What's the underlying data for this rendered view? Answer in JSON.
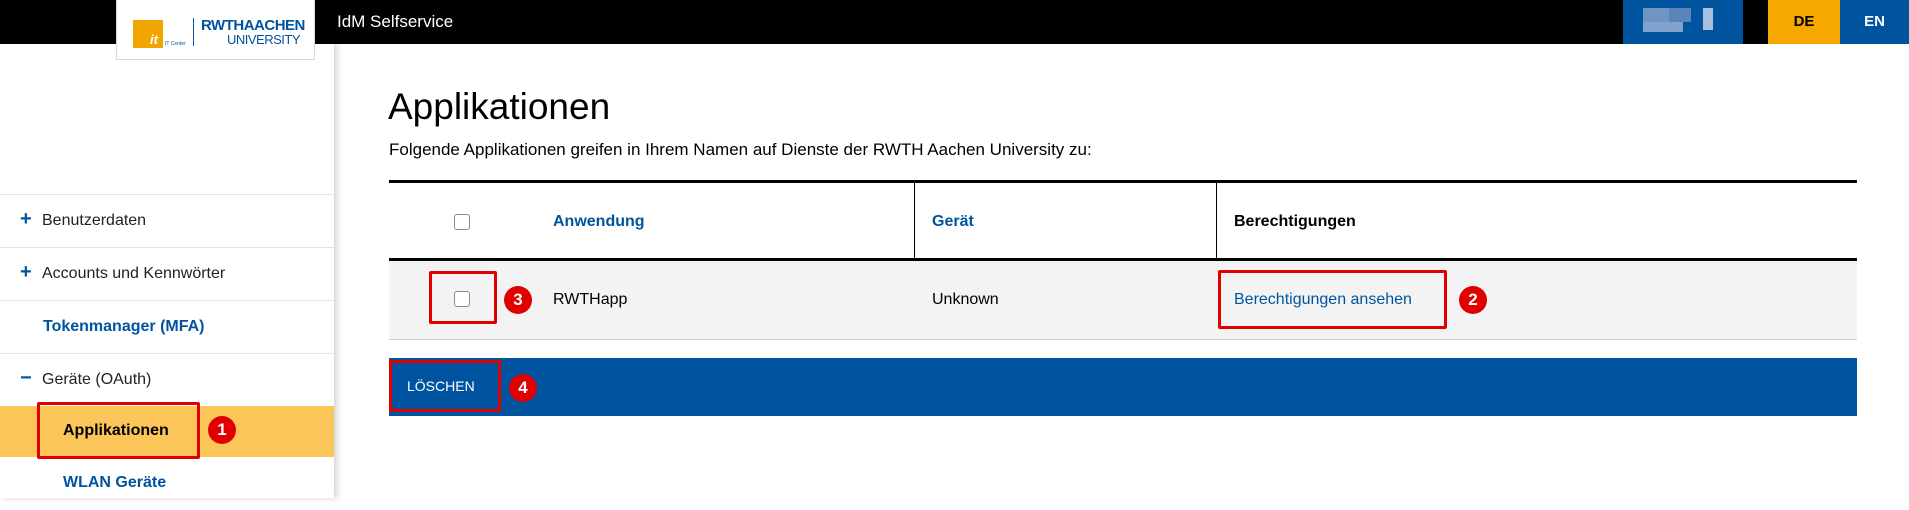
{
  "header": {
    "app_title": "IdM Selfservice",
    "logo": {
      "it_text": "it",
      "it_subtext": "IT Center",
      "rwth_text": "RWTHAACHEN",
      "university_text": "UNIVERSITY"
    },
    "lang_de": "DE",
    "lang_en": "EN",
    "colors": {
      "bar": "#000000",
      "de_bg": "#f6a800",
      "en_bg": "#00549f"
    }
  },
  "sidebar": {
    "items": [
      {
        "prefix": "+",
        "label": "Benutzerdaten"
      },
      {
        "prefix": "+",
        "label": "Accounts und Kennwörter"
      },
      {
        "prefix": "",
        "label": "Tokenmanager (MFA)"
      },
      {
        "prefix": "−",
        "label": "Geräte (OAuth)"
      },
      {
        "prefix": "",
        "label": "Applikationen",
        "active": true
      },
      {
        "prefix": "",
        "label": "WLAN Geräte"
      }
    ],
    "active_color": "#fbc55a"
  },
  "main": {
    "title": "Applikationen",
    "description": "Folgende Applikationen greifen in Ihrem Namen auf Dienste der RWTH Aachen University zu:",
    "table": {
      "columns": [
        "Anwendung",
        "Gerät",
        "Berechtigungen"
      ],
      "rows": [
        {
          "anwendung": "RWTHapp",
          "geraet": "Unknown",
          "berechtigungen": "Berechtigungen ansehen",
          "checked": false
        }
      ]
    },
    "delete_label": "LÖSCHEN",
    "accent_color": "#00549f"
  },
  "annotations": {
    "badges": [
      "1",
      "2",
      "3",
      "4"
    ],
    "color": "#e00000"
  }
}
